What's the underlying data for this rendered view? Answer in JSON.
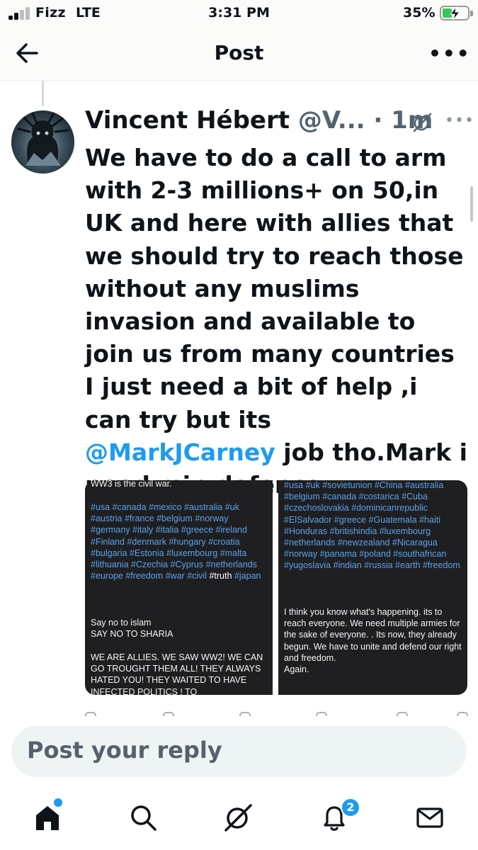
{
  "status_bar": {
    "carrier": "Fizz",
    "network": "LTE",
    "time": "3:31 PM",
    "battery_percent": "35%",
    "signal_bars_active": 2,
    "signal_bars_total": 4
  },
  "header": {
    "title": "Post",
    "back_icon": "arrow-left-icon",
    "more_icon": "more-horizontal-icon",
    "more_label": "•••"
  },
  "tweet": {
    "author_name": "Vincent Hébert",
    "handle": "@V...",
    "separator": "·",
    "time": "1m",
    "more_label": "•••",
    "text_before_mention": "We have to do a call to arm with 2-3 millions+ on 50,in UK and here with allies that we should try to reach those without any muslims invasion and available to join us from many countries\nI just need a bit of help ,i can try but its ",
    "mention": "@MarkJCarney",
    "text_after_mention": " job tho.Mark i need min.defence"
  },
  "media": {
    "left": {
      "heading": "WW3 is the civil war.",
      "hashtags": "#usa #canada #mexico #australia #uk #austria #france #belgium #norway #germany #italy #italia #greece #ireland #Finland #denmark #hungary #croatia #bulgaria #Estonia #luxembourg #malta #lithuania #Czechia #Cyprus #netherlands #europe #freedom #war #civil",
      "hashtag_tail_plain": " #truth",
      "hashtag_last": "#japan",
      "body_1": "Say no to islam",
      "body_2": "SAY NO TO SHARIA",
      "body_3": "WE ARE ALLIES. WE SAW WW2! WE CAN GO TROUGHT THEM ALL! THEY ALWAYS HATED YOU! THEY WAITED TO HAVE INFECTED POLITICS ! TO"
    },
    "right": {
      "hashtags": "#usa #uk #sovietunion #China #australia #belgium #canada #costarica #Cuba #czechoslovakia #dominicanrepublic #ElSalvador #greece #Guatemala #haiti #Honduras #britishindia #luxembourg #netherlands #newzealand #Nicaragua #norway #panama #poland #southafrican #yugoslavia #indian #russia #earth #freedom",
      "body": "I think you know what's happening. its to reach everyone. We need multiple armies for the sake of everyone. . Its now, they already begun. We have to unite and defend our right and freedom.\nAgain."
    }
  },
  "reply": {
    "placeholder": "Post your reply"
  },
  "tabbar": {
    "items": [
      {
        "icon": "home-icon",
        "active": true
      },
      {
        "icon": "search-icon"
      },
      {
        "icon": "grok-icon"
      },
      {
        "icon": "notifications-bell-icon"
      },
      {
        "icon": "messages-envelope-icon"
      }
    ],
    "notifications_badge": "2"
  },
  "colors": {
    "accent": "#1d9bf0",
    "text": "#0f1419",
    "muted": "#536471",
    "image_bg": "#1f1f22",
    "hashtag_in_image": "#5aa3ea",
    "battery_fill": "#35c759"
  }
}
